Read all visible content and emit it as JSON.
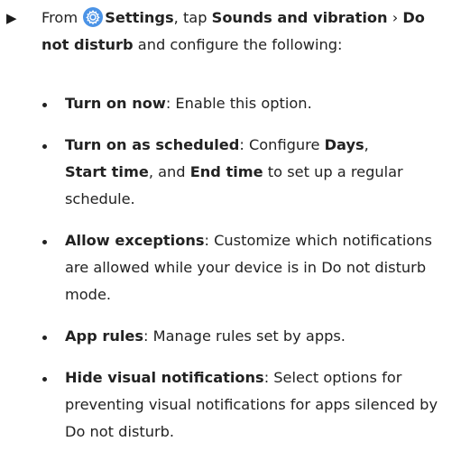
{
  "step": {
    "marker": "▶",
    "pre": "From ",
    "icon": "settings-gear-icon",
    "settings": "Settings",
    "tap": ", tap ",
    "sounds": "Sounds and vibration",
    "chevron": " › ",
    "dnd": "Do not disturb",
    "post": " and configure the following:"
  },
  "items": [
    {
      "title": "Turn on now",
      "text": ": Enable this option."
    },
    {
      "title": "Turn on as scheduled",
      "text_1": ": Configure ",
      "days": "Days",
      "comma": ",",
      "start": "Start time",
      "and": ", and ",
      "end": "End time",
      "text_2": " to set up a regular schedule."
    },
    {
      "title": "Allow exceptions",
      "text": ": Customize which notifications are allowed while your device is in Do not disturb mode."
    },
    {
      "title": "App rules",
      "text": ": Manage rules set by apps."
    },
    {
      "title": "Hide visual notifications",
      "text": ": Select options for preventing visual notifications for apps silenced by Do not disturb."
    }
  ],
  "colors": {
    "accent": "#4b93e6",
    "text": "#222222"
  }
}
